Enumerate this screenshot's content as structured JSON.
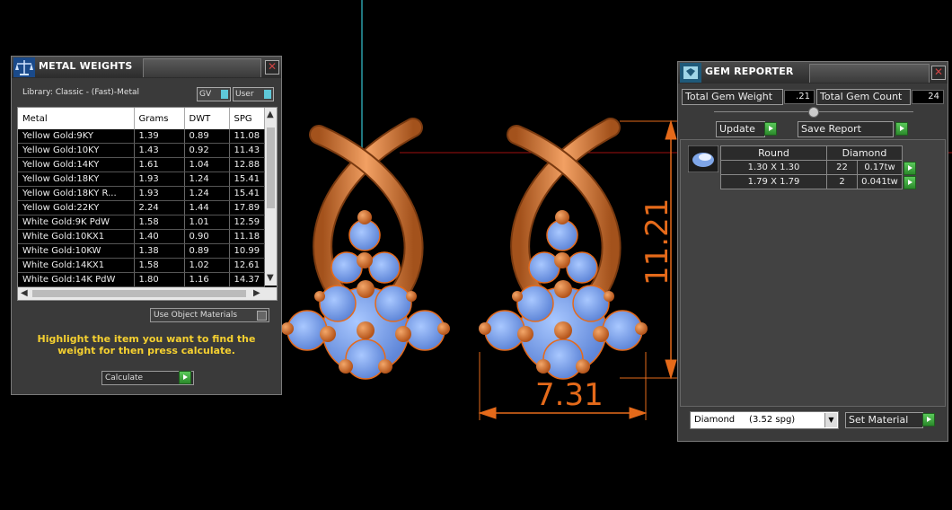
{
  "viewport": {
    "dimension_height": "11.21",
    "dimension_width": "7.31"
  },
  "metal_weights": {
    "title": "METAL WEIGHTS",
    "library": "Library: Classic - (Fast)-Metal",
    "toggle_gv": "GV",
    "toggle_user": "User",
    "columns": [
      "Metal",
      "Grams",
      "DWT",
      "SPG"
    ],
    "rows": [
      [
        "Yellow Gold:9KY",
        "1.39",
        "0.89",
        "11.08"
      ],
      [
        "Yellow Gold:10KY",
        "1.43",
        "0.92",
        "11.43"
      ],
      [
        "Yellow Gold:14KY",
        "1.61",
        "1.04",
        "12.88"
      ],
      [
        "Yellow Gold:18KY",
        "1.93",
        "1.24",
        "15.41"
      ],
      [
        "Yellow Gold:18KY R...",
        "1.93",
        "1.24",
        "15.41"
      ],
      [
        "Yellow Gold:22KY",
        "2.24",
        "1.44",
        "17.89"
      ],
      [
        "White Gold:9K PdW",
        "1.58",
        "1.01",
        "12.59"
      ],
      [
        "White Gold:10KX1",
        "1.40",
        "0.90",
        "11.18"
      ],
      [
        "White Gold:10KW",
        "1.38",
        "0.89",
        "10.99"
      ],
      [
        "White Gold:14KX1",
        "1.58",
        "1.02",
        "12.61"
      ],
      [
        "White Gold:14K PdW",
        "1.80",
        "1.16",
        "14.37"
      ]
    ],
    "use_object_materials": "Use Object Materials",
    "hint": "Highlight the item you want to find the weight for then press calculate.",
    "calculate_label": "Calculate"
  },
  "gem_reporter": {
    "title": "GEM REPORTER",
    "total_weight_label": "Total Gem Weight",
    "total_weight_value": ".21",
    "total_count_label": "Total Gem Count",
    "total_count_value": "24",
    "update_label": "Update",
    "save_report_label": "Save Report",
    "table_headers": [
      "Round",
      "Diamond"
    ],
    "gems": [
      {
        "size": "1.30 X 1.30",
        "count": "22",
        "weight": "0.17tw"
      },
      {
        "size": "1.79 X 1.79",
        "count": "2",
        "weight": "0.041tw"
      }
    ],
    "material_select": "Diamond     (3.52 spg)",
    "set_material_label": "Set Material"
  },
  "colors": {
    "accent_orange": "#e56a1a",
    "hint_yellow": "#f5d030",
    "go_green": "#3aa83a",
    "guide_cyan": "#2a9ea8"
  },
  "icons": {
    "metal_weights": "scale-icon",
    "gem_reporter": "gem-report-icon",
    "close": "close-icon",
    "go": "play-arrow-icon",
    "gem_thumb": "gem-thumbnail-icon"
  }
}
